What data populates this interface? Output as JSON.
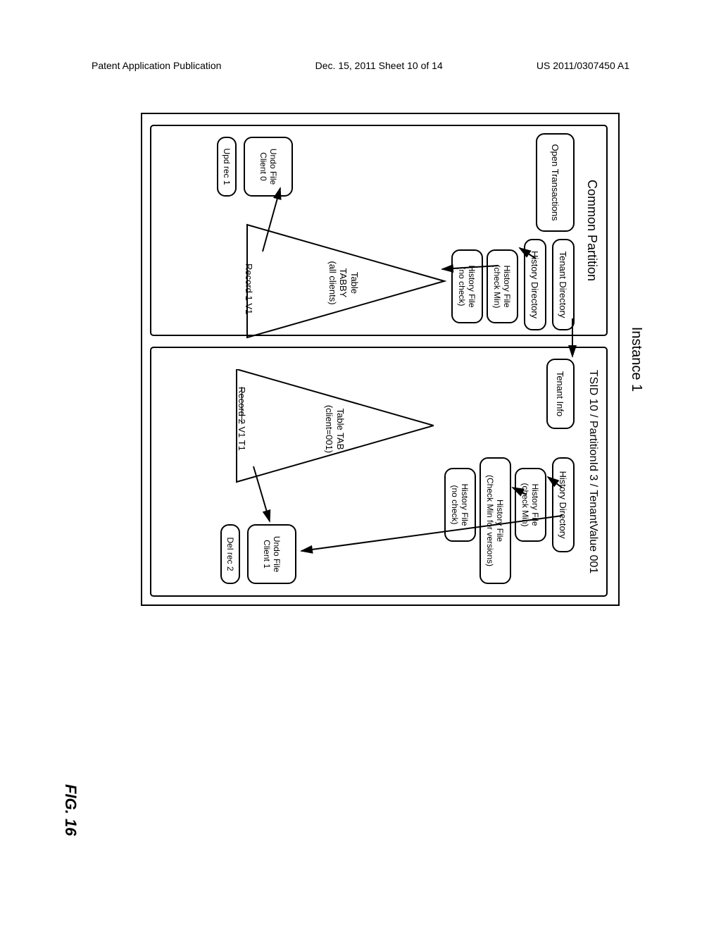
{
  "header": {
    "left": "Patent Application Publication",
    "center": "Dec. 15, 2011  Sheet 10 of 14",
    "right": "US 2011/0307450 A1"
  },
  "figure": {
    "label": "FIG. 16",
    "instance": "Instance 1",
    "common": {
      "title": "Common Partition",
      "open_transactions": "Open Transactions",
      "tenant_directory": "Tenant Directory",
      "history_directory": "History Directory",
      "history_file_a_l1": "History File",
      "history_file_a_l2": "(check Min)",
      "history_file_b_l1": "History File",
      "history_file_b_l2": "(no check)",
      "tree_label_l1": "Table",
      "tree_label_l2": "TABBY",
      "tree_label_l3": "(all clients)",
      "record": "Record 1 V1",
      "undo_file_l1": "Undo File",
      "undo_file_l2": "Client 0",
      "upd_rec": "Upd rec 1"
    },
    "tsid": {
      "title": "TSID 10 / PartitionId 3 / TenantValue 001",
      "tenant_info": "Tenant Info",
      "history_directory": "History Directory",
      "history_file_a_l1": "History File",
      "history_file_a_l2": "(check Min)",
      "history_file_b_l1": "History File",
      "history_file_b_l2": "(Check Min for versions)",
      "history_file_c_l1": "History File",
      "history_file_c_l2": "(no check)",
      "tree_label_l1": "Table TAB",
      "tree_label_l2": "(client=001)",
      "record_strike": "Record 2",
      "record_suffix": " V1 T1",
      "undo_file_l1": "Undo File",
      "undo_file_l2": "Client 1",
      "del_rec": "Del rec 2"
    }
  }
}
